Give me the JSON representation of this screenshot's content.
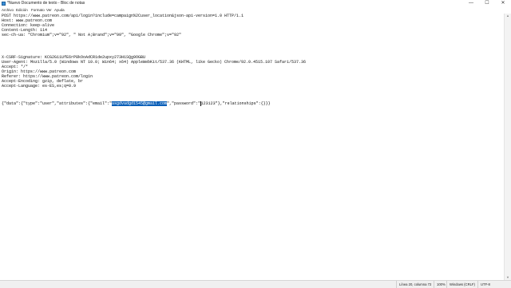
{
  "window": {
    "title": "*Nuevo Documento de texto - Bloc de notas",
    "controls": {
      "minimize": "—",
      "maximize": "☐",
      "close": "✕"
    }
  },
  "menu": [
    "Archivo",
    "Edición",
    "Formato",
    "Ver",
    "Ayuda"
  ],
  "editor": {
    "lines": [
      "POST https://www.patreon.com/api/login?include=campaign%2Cuser_location&json-api-version=1.0 HTTP/1.1",
      "Host: www.patreon.com",
      "Connection: keep-alive",
      "Content-Length: 114",
      "sec-ch-ua: \"Chromium\";v=\"92\", \" Not A;Brand\";v=\"99\", \"Google Chrome\";v=\"92\"",
      "",
      "",
      "",
      "",
      "X-CSRF-Signature: KCG2G11UfE6rP8kOoAdCR1de2upxy273H1SQg9OGBU",
      "User-Agent: Mozilla/5.0 (Windows NT 10.0; Win64; x64) AppleWebKit/537.36 (KHTML, like Gecko) Chrome/92.0.4515.107 Safari/537.36",
      "Accept: */*",
      "Origin: https://www.patreon.com",
      "Referer: https://www.patreon.com/login",
      "Accept-Encoding: gzip, deflate, br",
      "Accept-Language: es-ES,es;q=0.9",
      "",
      "",
      "",
      ""
    ],
    "json_line": {
      "before": "{\"data\":{\"type\":\"user\",\"attributes\":{\"email\":\"",
      "selected": "asgdvadgd1545@gmail.com",
      "middle": "\",\"password\":\"",
      "after_caret": "123123\"},\"relationships\":{}}}"
    }
  },
  "status": {
    "position": "Línea 20, columna 72",
    "zoom": "100%",
    "line_ending": "Windows (CRLF)",
    "encoding": "UTF-8"
  },
  "colors": {
    "selection": "#0a5fb8"
  }
}
